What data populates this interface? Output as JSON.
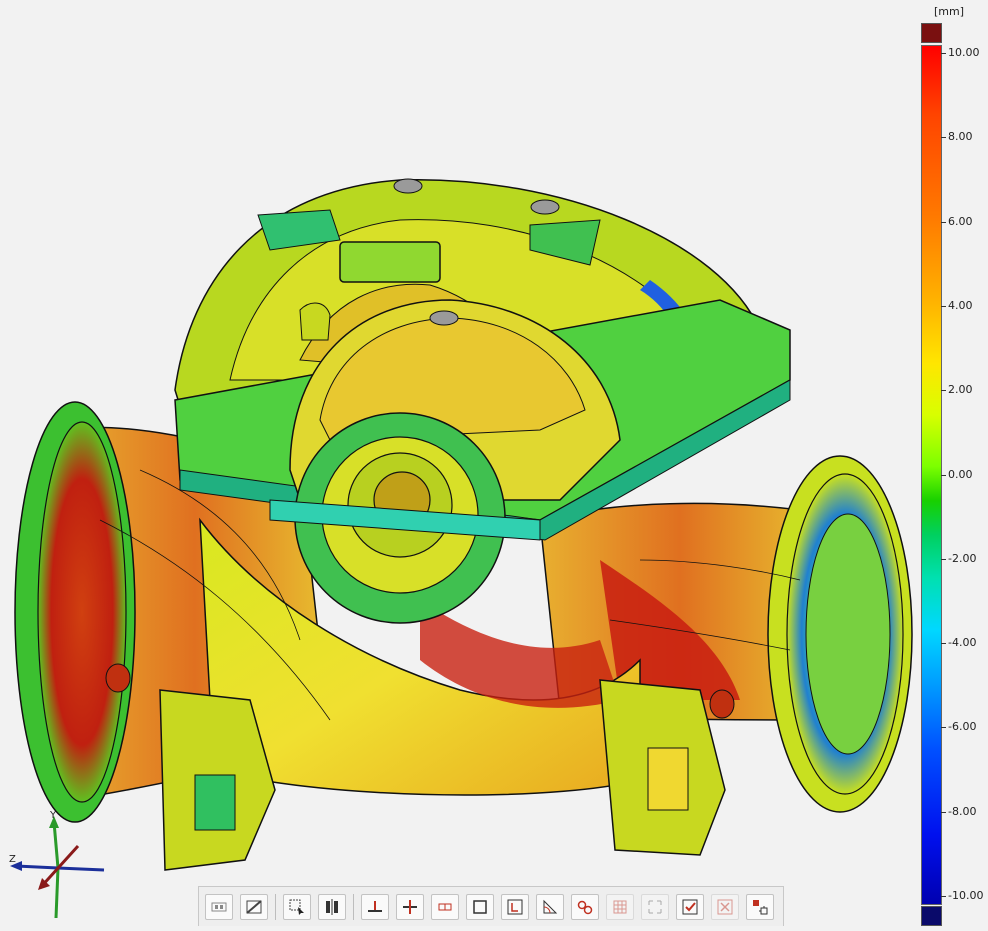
{
  "legend": {
    "unit": "[mm]",
    "ticks": [
      "10.00",
      "8.00",
      "6.00",
      "4.00",
      "2.00",
      "0.00",
      "-2.00",
      "-4.00",
      "-6.00",
      "-8.00",
      "-10.00"
    ],
    "max_color": "#7a1010",
    "min_color": "#0a0a6a"
  },
  "triad": {
    "x_label": "",
    "y_label": "Y",
    "z_label": "Z"
  },
  "toolbar": {
    "buttons": [
      {
        "name": "view-mode-icon",
        "enabled": true
      },
      {
        "name": "section-toggle-icon",
        "enabled": true
      },
      {
        "name": "select-rectangle-icon",
        "enabled": true
      },
      {
        "name": "split-view-icon",
        "enabled": true
      },
      {
        "name": "align-plane-icon",
        "enabled": true
      },
      {
        "name": "distance-icon",
        "enabled": true
      },
      {
        "name": "dimension-icon",
        "enabled": true
      },
      {
        "name": "frame-icon",
        "enabled": true
      },
      {
        "name": "fit-frame-icon",
        "enabled": true
      },
      {
        "name": "angle-icon",
        "enabled": true
      },
      {
        "name": "link-icon",
        "enabled": true
      },
      {
        "name": "grid-icon",
        "enabled": false
      },
      {
        "name": "expand-icon",
        "enabled": false
      },
      {
        "name": "check-icon",
        "enabled": true
      },
      {
        "name": "cancel-icon",
        "enabled": false
      },
      {
        "name": "transform-icon",
        "enabled": true
      }
    ]
  }
}
